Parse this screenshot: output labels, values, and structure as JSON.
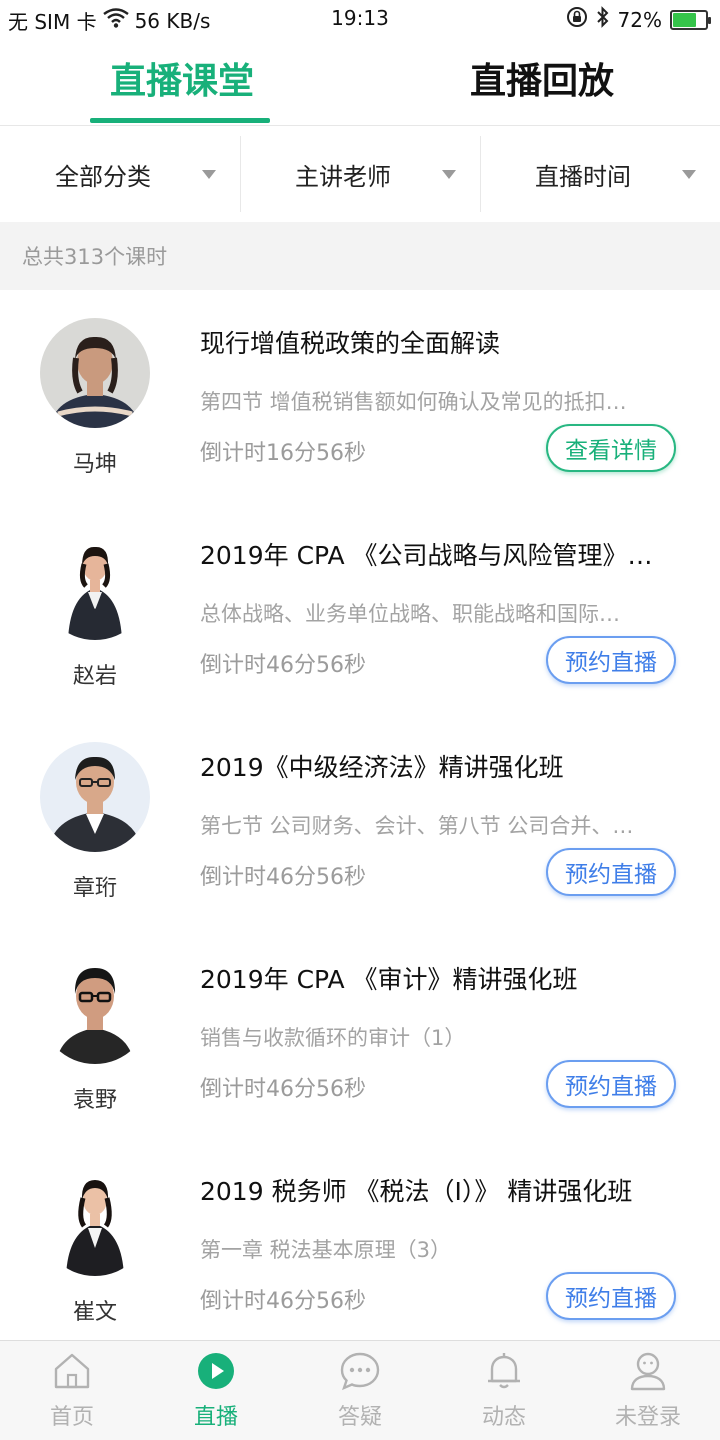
{
  "status_bar": {
    "sim": "无 SIM 卡",
    "speed": "56 KB/s",
    "time": "19:13",
    "battery_pct": "72%",
    "battery_level": 0.72,
    "icons": [
      "wifi-icon",
      "rotation-lock-icon",
      "bluetooth-icon",
      "battery-icon"
    ]
  },
  "top_tabs": {
    "live": "直播课堂",
    "replay": "直播回放",
    "active": "live",
    "accent": "#18b07a"
  },
  "filters": [
    {
      "label": "全部分类"
    },
    {
      "label": "主讲老师"
    },
    {
      "label": "直播时间"
    }
  ],
  "count_text": "总共313个课时",
  "courses": [
    {
      "teacher": "马坤",
      "title": "现行增值税政策的全面解读",
      "subtitle": "第四节 增值税销售额如何确认及常见的抵扣…",
      "countdown": "倒计时16分56秒",
      "button": "查看详情",
      "button_style": "detail"
    },
    {
      "teacher": "赵岩",
      "title": "2019年 CPA 《公司战略与风险管理》…",
      "subtitle": "总体战略、业务单位战略、职能战略和国际…",
      "countdown": "倒计时46分56秒",
      "button": "预约直播",
      "button_style": "reserve"
    },
    {
      "teacher": "章珩",
      "title": "2019《中级经济法》精讲强化班",
      "subtitle": "第七节 公司财务、会计、第八节 公司合并、…",
      "countdown": "倒计时46分56秒",
      "button": "预约直播",
      "button_style": "reserve"
    },
    {
      "teacher": "袁野",
      "title": "2019年 CPA 《审计》精讲强化班",
      "subtitle": "销售与收款循环的审计（1）",
      "countdown": "倒计时46分56秒",
      "button": "预约直播",
      "button_style": "reserve"
    },
    {
      "teacher": "崔文",
      "title": "2019 税务师 《税法（I）》 精讲强化班",
      "subtitle": "第一章 税法基本原理（3）",
      "countdown": "倒计时46分56秒",
      "button": "预约直播",
      "button_style": "reserve"
    }
  ],
  "bottom_nav": [
    {
      "label": "首页",
      "icon": "home-icon"
    },
    {
      "label": "直播",
      "icon": "play-icon",
      "active": true
    },
    {
      "label": "答疑",
      "icon": "chat-icon"
    },
    {
      "label": "动态",
      "icon": "bell-icon"
    },
    {
      "label": "未登录",
      "icon": "user-icon"
    }
  ]
}
